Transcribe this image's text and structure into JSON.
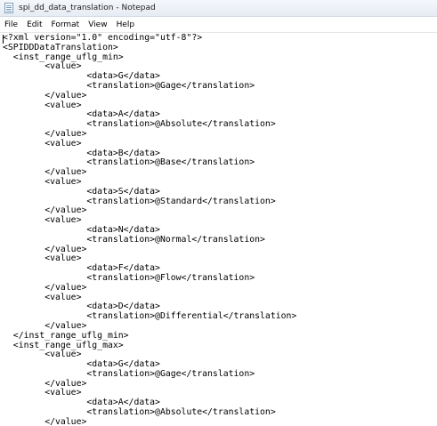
{
  "window": {
    "title": "spi_dd_data_translation - Notepad"
  },
  "menu": {
    "file": "File",
    "edit": "Edit",
    "format": "Format",
    "view": "View",
    "help": "Help"
  },
  "document": {
    "lines": [
      "<?xml version=\"1.0\" encoding=\"utf-8\"?>",
      "<SPIDDDataTranslation>",
      "  <inst_range_uflg_min>",
      "\t<value>",
      "\t\t<data>G</data>",
      "\t\t<translation>@Gage</translation>",
      "\t</value>",
      "\t<value>",
      "\t\t<data>A</data>",
      "\t\t<translation>@Absolute</translation>",
      "\t</value>",
      "\t<value>",
      "\t\t<data>B</data>",
      "\t\t<translation>@Base</translation>",
      "\t</value>",
      "\t<value>",
      "\t\t<data>S</data>",
      "\t\t<translation>@Standard</translation>",
      "\t</value>",
      "\t<value>",
      "\t\t<data>N</data>",
      "\t\t<translation>@Normal</translation>",
      "\t</value>",
      "\t<value>",
      "\t\t<data>F</data>",
      "\t\t<translation>@Flow</translation>",
      "\t</value>",
      "\t<value>",
      "\t\t<data>D</data>",
      "\t\t<translation>@Differential</translation>",
      "\t</value>",
      "  </inst_range_uflg_min>",
      "  <inst_range_uflg_max>",
      "\t<value>",
      "\t\t<data>G</data>",
      "\t\t<translation>@Gage</translation>",
      "\t</value>",
      "\t<value>",
      "\t\t<data>A</data>",
      "\t\t<translation>@Absolute</translation>",
      "\t</value>"
    ]
  }
}
